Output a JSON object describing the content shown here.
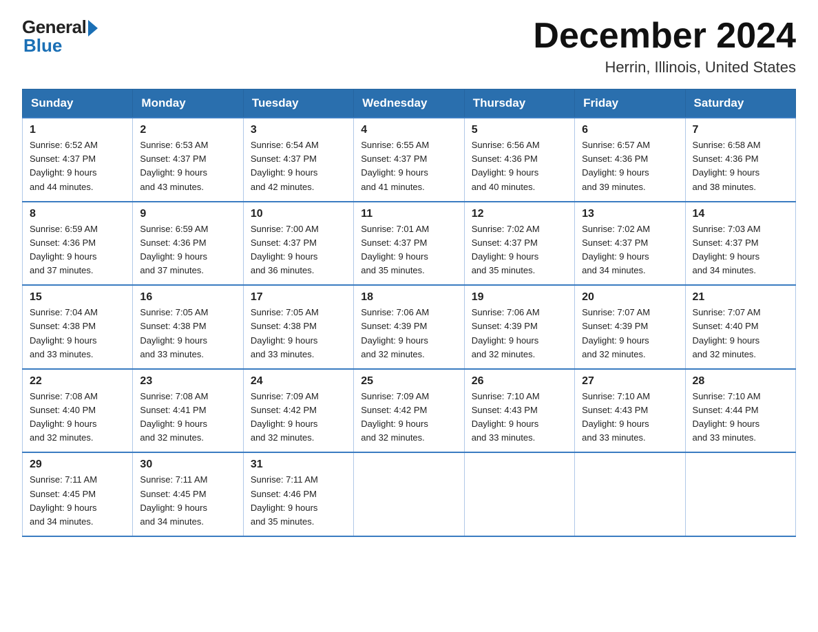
{
  "header": {
    "logo_general": "General",
    "logo_blue": "Blue",
    "month_title": "December 2024",
    "location": "Herrin, Illinois, United States"
  },
  "days_of_week": [
    "Sunday",
    "Monday",
    "Tuesday",
    "Wednesday",
    "Thursday",
    "Friday",
    "Saturday"
  ],
  "weeks": [
    [
      {
        "day": "1",
        "sunrise": "6:52 AM",
        "sunset": "4:37 PM",
        "daylight": "9 hours and 44 minutes."
      },
      {
        "day": "2",
        "sunrise": "6:53 AM",
        "sunset": "4:37 PM",
        "daylight": "9 hours and 43 minutes."
      },
      {
        "day": "3",
        "sunrise": "6:54 AM",
        "sunset": "4:37 PM",
        "daylight": "9 hours and 42 minutes."
      },
      {
        "day": "4",
        "sunrise": "6:55 AM",
        "sunset": "4:37 PM",
        "daylight": "9 hours and 41 minutes."
      },
      {
        "day": "5",
        "sunrise": "6:56 AM",
        "sunset": "4:36 PM",
        "daylight": "9 hours and 40 minutes."
      },
      {
        "day": "6",
        "sunrise": "6:57 AM",
        "sunset": "4:36 PM",
        "daylight": "9 hours and 39 minutes."
      },
      {
        "day": "7",
        "sunrise": "6:58 AM",
        "sunset": "4:36 PM",
        "daylight": "9 hours and 38 minutes."
      }
    ],
    [
      {
        "day": "8",
        "sunrise": "6:59 AM",
        "sunset": "4:36 PM",
        "daylight": "9 hours and 37 minutes."
      },
      {
        "day": "9",
        "sunrise": "6:59 AM",
        "sunset": "4:36 PM",
        "daylight": "9 hours and 37 minutes."
      },
      {
        "day": "10",
        "sunrise": "7:00 AM",
        "sunset": "4:37 PM",
        "daylight": "9 hours and 36 minutes."
      },
      {
        "day": "11",
        "sunrise": "7:01 AM",
        "sunset": "4:37 PM",
        "daylight": "9 hours and 35 minutes."
      },
      {
        "day": "12",
        "sunrise": "7:02 AM",
        "sunset": "4:37 PM",
        "daylight": "9 hours and 35 minutes."
      },
      {
        "day": "13",
        "sunrise": "7:02 AM",
        "sunset": "4:37 PM",
        "daylight": "9 hours and 34 minutes."
      },
      {
        "day": "14",
        "sunrise": "7:03 AM",
        "sunset": "4:37 PM",
        "daylight": "9 hours and 34 minutes."
      }
    ],
    [
      {
        "day": "15",
        "sunrise": "7:04 AM",
        "sunset": "4:38 PM",
        "daylight": "9 hours and 33 minutes."
      },
      {
        "day": "16",
        "sunrise": "7:05 AM",
        "sunset": "4:38 PM",
        "daylight": "9 hours and 33 minutes."
      },
      {
        "day": "17",
        "sunrise": "7:05 AM",
        "sunset": "4:38 PM",
        "daylight": "9 hours and 33 minutes."
      },
      {
        "day": "18",
        "sunrise": "7:06 AM",
        "sunset": "4:39 PM",
        "daylight": "9 hours and 32 minutes."
      },
      {
        "day": "19",
        "sunrise": "7:06 AM",
        "sunset": "4:39 PM",
        "daylight": "9 hours and 32 minutes."
      },
      {
        "day": "20",
        "sunrise": "7:07 AM",
        "sunset": "4:39 PM",
        "daylight": "9 hours and 32 minutes."
      },
      {
        "day": "21",
        "sunrise": "7:07 AM",
        "sunset": "4:40 PM",
        "daylight": "9 hours and 32 minutes."
      }
    ],
    [
      {
        "day": "22",
        "sunrise": "7:08 AM",
        "sunset": "4:40 PM",
        "daylight": "9 hours and 32 minutes."
      },
      {
        "day": "23",
        "sunrise": "7:08 AM",
        "sunset": "4:41 PM",
        "daylight": "9 hours and 32 minutes."
      },
      {
        "day": "24",
        "sunrise": "7:09 AM",
        "sunset": "4:42 PM",
        "daylight": "9 hours and 32 minutes."
      },
      {
        "day": "25",
        "sunrise": "7:09 AM",
        "sunset": "4:42 PM",
        "daylight": "9 hours and 32 minutes."
      },
      {
        "day": "26",
        "sunrise": "7:10 AM",
        "sunset": "4:43 PM",
        "daylight": "9 hours and 33 minutes."
      },
      {
        "day": "27",
        "sunrise": "7:10 AM",
        "sunset": "4:43 PM",
        "daylight": "9 hours and 33 minutes."
      },
      {
        "day": "28",
        "sunrise": "7:10 AM",
        "sunset": "4:44 PM",
        "daylight": "9 hours and 33 minutes."
      }
    ],
    [
      {
        "day": "29",
        "sunrise": "7:11 AM",
        "sunset": "4:45 PM",
        "daylight": "9 hours and 34 minutes."
      },
      {
        "day": "30",
        "sunrise": "7:11 AM",
        "sunset": "4:45 PM",
        "daylight": "9 hours and 34 minutes."
      },
      {
        "day": "31",
        "sunrise": "7:11 AM",
        "sunset": "4:46 PM",
        "daylight": "9 hours and 35 minutes."
      },
      null,
      null,
      null,
      null
    ]
  ],
  "labels": {
    "sunrise": "Sunrise:",
    "sunset": "Sunset:",
    "daylight": "Daylight:"
  }
}
